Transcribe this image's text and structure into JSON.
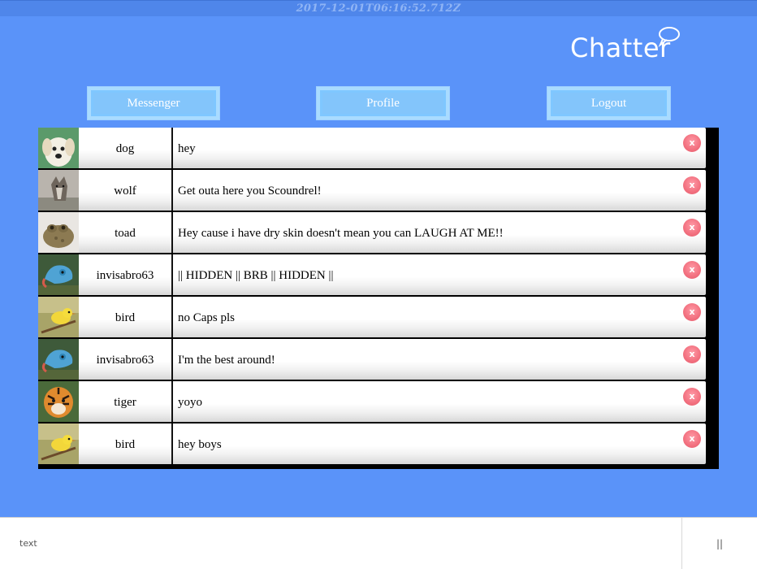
{
  "timestamp": "2017-12-01T06:16:52.712Z",
  "app": {
    "logo_text": "Chatter",
    "logo_icon": "speech-bubble-icon"
  },
  "nav": {
    "messenger_label": "Messenger",
    "profile_label": "Profile",
    "logout_label": "Logout"
  },
  "messages": [
    {
      "user": "dog",
      "avatar": "dog-avatar",
      "text": "hey",
      "delete": "x"
    },
    {
      "user": "wolf",
      "avatar": "wolf-avatar",
      "text": "Get outa here you Scoundrel!",
      "delete": "x"
    },
    {
      "user": "toad",
      "avatar": "toad-avatar",
      "text": "Hey cause i have dry skin doesn't mean you can LAUGH AT ME!!",
      "delete": "x"
    },
    {
      "user": "invisabro63",
      "avatar": "chameleon-avatar",
      "text": "|| HIDDEN || BRB || HIDDEN ||",
      "delete": "x"
    },
    {
      "user": "bird",
      "avatar": "bird-avatar",
      "text": "no Caps pls",
      "delete": "x"
    },
    {
      "user": "invisabro63",
      "avatar": "chameleon-avatar",
      "text": "I'm the best around!",
      "delete": "x"
    },
    {
      "user": "tiger",
      "avatar": "tiger-avatar",
      "text": "yoyo",
      "delete": "x"
    },
    {
      "user": "bird",
      "avatar": "bird-avatar",
      "text": "hey boys",
      "delete": "x"
    }
  ],
  "composer": {
    "placeholder": "text",
    "send_label": "||"
  },
  "colors": {
    "background": "#5a93f9",
    "button": "#83c5fb",
    "delete": "#f2707f"
  }
}
